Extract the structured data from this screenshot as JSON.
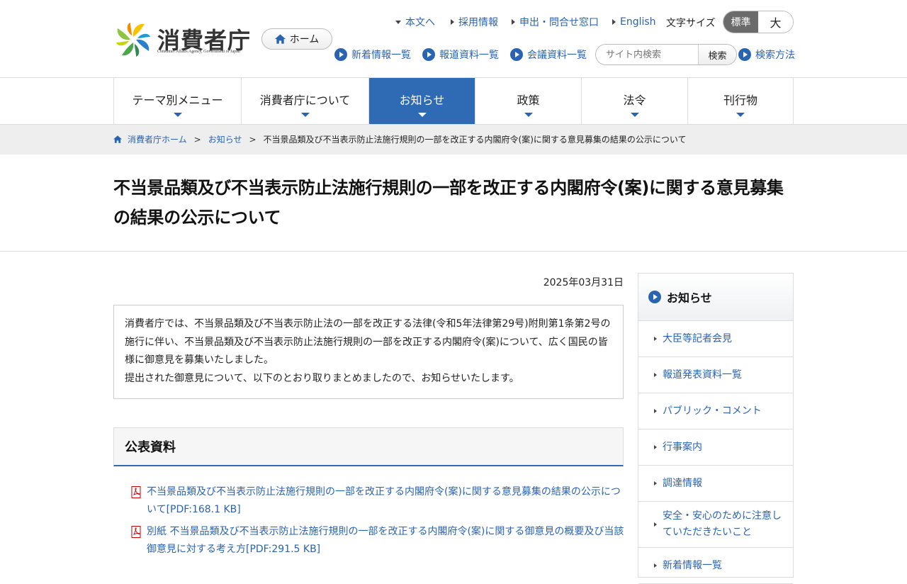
{
  "header": {
    "logo_title": "消費者庁",
    "logo_subtitle": "Consumer Affairs Agency, Government of Japan",
    "home_label": "ホーム",
    "util_links": [
      "本文へ",
      "採用情報",
      "申出・問合せ窓口",
      "English"
    ],
    "font_size_label": "文字サイズ",
    "font_size_options": [
      "標準",
      "大"
    ],
    "font_size_selected": "標準",
    "sub_links": [
      "新着情報一覧",
      "報道資料一覧",
      "会議資料一覧"
    ],
    "search_placeholder": "サイト内検索",
    "search_button": "検索",
    "search_help": "検索方法"
  },
  "nav": {
    "items": [
      "テーマ別メニュー",
      "消費者庁について",
      "お知らせ",
      "政策",
      "法令",
      "刊行物"
    ],
    "active": "お知らせ"
  },
  "breadcrumb": {
    "home": "消費者庁ホーム",
    "parent": "お知らせ",
    "current": "不当景品類及び不当表示防止法施行規則の一部を改正する内閣府令(案)に関する意見募集の結果の公示について"
  },
  "page": {
    "title": "不当景品類及び不当表示防止法施行規則の一部を改正する内閣府令(案)に関する意見募集の結果の公示について",
    "date": "2025年03月31日",
    "intro_1": "消費者庁では、不当景品類及び不当表示防止法の一部を改正する法律(令和5年法律第29号)附則第1条第2号の施行に伴い、不当景品類及び不当表示防止法施行規則の一部を改正する内閣府令(案)について、広く国民の皆様に御意見を募集いたしました。",
    "intro_2": "提出された御意見について、以下のとおり取りまとめましたので、お知らせいたします。",
    "section_title": "公表資料",
    "documents": [
      "不当景品類及び不当表示防止法施行規則の一部を改正する内閣府令(案)に関する意見募集の結果の公示について[PDF:168.1 KB]",
      "別紙 不当景品類及び不当表示防止法施行規則の一部を改正する内閣府令(案)に関する御意見の概要及び当該御意見に対する考え方[PDF:291.5 KB]"
    ]
  },
  "sidebar": {
    "title": "お知らせ",
    "items": [
      "大臣等記者会見",
      "報道発表資料一覧",
      "パブリック・コメント",
      "行事案内",
      "調達情報",
      "安全・安心のために注意していただきたいこと",
      "新着情報一覧"
    ]
  },
  "colors": {
    "accent": "#2f6ab4",
    "link": "#2a63b0",
    "breadcrumb_bg": "#eeeeee"
  }
}
